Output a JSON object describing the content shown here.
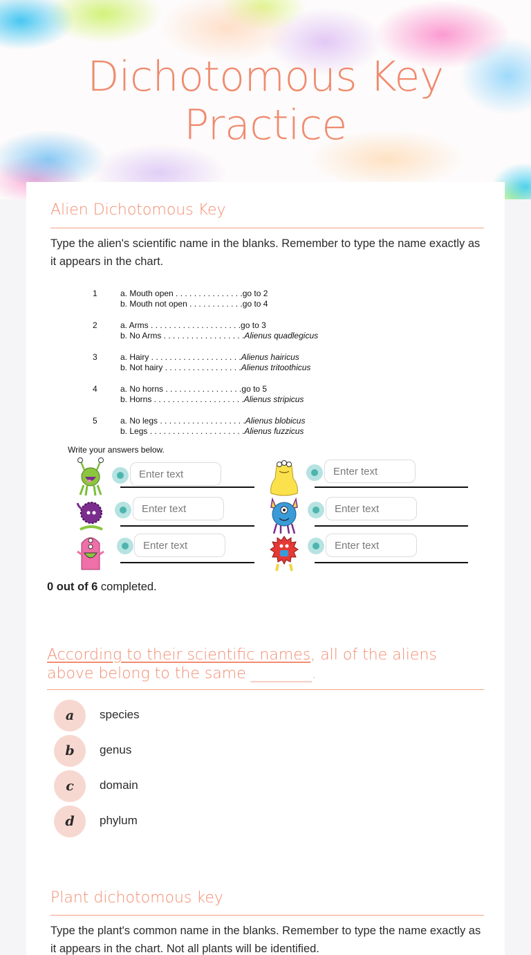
{
  "header": {
    "title_line1": "Dichotomous Key",
    "title_line2": "Practice"
  },
  "alien_section": {
    "title": "Alien Dichotomous Key",
    "instructions": "Type the alien's scientific name in the blanks.  Remember to type the name exactly as it appears in the chart.",
    "key": [
      {
        "num": "1",
        "a": "a. Mouth open . . . . . . . . . . . . . . .",
        "a_result": "go to 2",
        "a_italic": false,
        "b": "b. Mouth not open . . . . . . . . . . . .",
        "b_result": "go to 4",
        "b_italic": false
      },
      {
        "num": "2",
        "a": "a. Arms . . . . . . . . . . . . . . . . . . . .",
        "a_result": "go to 3",
        "a_italic": false,
        "b": "b. No Arms . . . . . . . . . . . . . . . . . .",
        "b_result": "Alienus quadlegicus",
        "b_italic": true
      },
      {
        "num": "3",
        "a": "a. Hairy . . . . . . . . . . . . . . . . . . . .",
        "a_result": "Alienus hairicus",
        "a_italic": true,
        "b": "b. Not hairy . . . . . . . . . . . . . . . . .",
        "b_result": "Alienus tritoothicus",
        "b_italic": true
      },
      {
        "num": "4",
        "a": "a. No horns . . . . . . . . . . . . . . . . .",
        "a_result": "go to 5",
        "a_italic": false,
        "b": "b. Horns . . . . . . . . . . . . . . . . . . . .",
        "b_result": "Alienus stripicus",
        "b_italic": true
      },
      {
        "num": "5",
        "a": "a. No legs . . . . . . . . . . . . . . . . . . .",
        "a_result": "Alienus blobicus",
        "a_italic": true,
        "b": "b. Legs . . . . . . . . . . . . . . . . . . . . .",
        "b_result": "Alienus fuzzicus",
        "b_italic": true
      }
    ],
    "write_label": "Write your answers below.",
    "answers": [
      {
        "alien": "green-antenna-alien",
        "value": "",
        "placeholder": "Enter text"
      },
      {
        "alien": "yellow-blob-alien",
        "value": "",
        "placeholder": "Enter text"
      },
      {
        "alien": "purple-fuzzy-alien",
        "value": "",
        "placeholder": "Enter text"
      },
      {
        "alien": "blue-horned-alien",
        "value": "",
        "placeholder": "Enter text"
      },
      {
        "alien": "pink-three-eyed-alien",
        "value": "",
        "placeholder": "Enter text"
      },
      {
        "alien": "red-hairy-alien",
        "value": "",
        "placeholder": "Enter text"
      }
    ],
    "completed_count": "0 out of 6",
    "completed_suffix": " completed."
  },
  "question": {
    "underlined": "According to their scientific names",
    "rest": ", all of the aliens above belong to the same ________.",
    "options": [
      {
        "letter": "a",
        "label": "species"
      },
      {
        "letter": "b",
        "label": "genus"
      },
      {
        "letter": "c",
        "label": "domain"
      },
      {
        "letter": "d",
        "label": "phylum"
      }
    ]
  },
  "plant_section": {
    "title": "Plant dichotomous key",
    "instructions": "Type the plant's common name in the blanks.  Remember to type the name exactly as it appears in the chart. Not all plants will be identified."
  },
  "colors": {
    "accent": "#f28c70",
    "teal_dot": "#4db4ae",
    "option_badge": "#f7d8d0"
  }
}
